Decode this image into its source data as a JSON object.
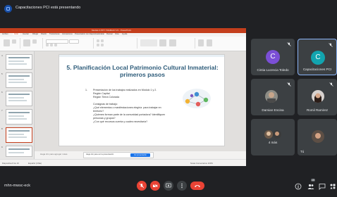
{
  "banner": {
    "text": "Capacitaciones PCI está presentando"
  },
  "powerpoint": {
    "window_title": "Modulo 3 PPT TRABAJO V3 - PowerPoint",
    "ribbon_tabs": [
      "Archivo",
      "Inicio",
      "Insertar",
      "Dibujar",
      "Diseño",
      "Transiciones",
      "Animaciones",
      "Presentación con diapositivas",
      "Grabar",
      "Revisar",
      "Vista",
      "Ayuda"
    ],
    "slide_numbers": [
      "4",
      "5",
      "6",
      "7",
      "8",
      "9"
    ],
    "notes_placeholder": "Haga clic para agregar notas",
    "status_left": "Diapositiva 8 de 16",
    "status_lang": "Español (Chile)",
    "status_right": "Notas   Comentarios   100%",
    "notification_text": "Haga clic para ver la presentación",
    "notification_button": "Ver presentación"
  },
  "slide": {
    "title_line1": "5. Planificación Local Patrimonio Cultural Inmaterial:",
    "title_line2": "primeros pasos",
    "body": [
      "1.        Presentación de los trabajos realizados en Módulo 1 y 2.",
      "           Región Capital",
      "           Región Tierra Colorada",
      "",
      "           Consignas de trabajo:",
      "           ¿Qué elementos o manifestaciones elegiría  para trabajar en",
      "           territorio?",
      "           ¿Quienes forman parte de la comunidad portadora? Identifiquen",
      "           personas y grupos?",
      "           ¿Con qué recursos cuenta y cuales necesitaría?"
    ]
  },
  "participants": [
    {
      "name": "Cintia Lucrecia Toledo",
      "initial": "C",
      "color": "#7b4fd6"
    },
    {
      "name": "Capacitaciones PCI",
      "initial": "C",
      "color": "#12a4af"
    },
    {
      "name": "Damian Encina",
      "initial": "",
      "color": ""
    },
    {
      "name": "Romil Ramirez",
      "initial": "",
      "color": ""
    },
    {
      "name": "4 más",
      "initial": "",
      "color": ""
    },
    {
      "name": "Tú",
      "initial": "",
      "color": ""
    }
  ],
  "meeting": {
    "code": "mhn-mwsc-eck",
    "participant_count": "10"
  }
}
